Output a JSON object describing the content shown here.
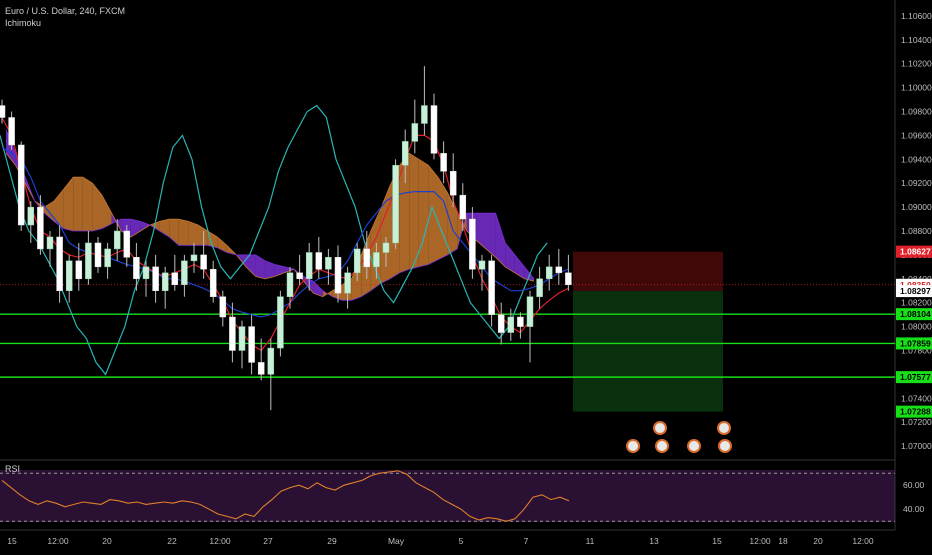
{
  "symbol_title": "Euro / U.S. Dollar, 240, FXCM",
  "indicator_name": "Ichimoku",
  "rsi_name": "RSI",
  "colors": {
    "background": "#000000",
    "up_candle": "#c8f0d8",
    "down_candle": "#ffffff",
    "wick": "#bfbfbf",
    "tenkan": "#e0202a",
    "kijun": "#1f3fcf",
    "chikou": "#2ab5b5",
    "cloud_bull": "#c7782e",
    "cloud_bear": "#7a2fd6",
    "level_line": "#18e018",
    "rsi_line": "#e0802a",
    "rsi_band": "#2a1033",
    "current_price": "#e0202a"
  },
  "price_axis": {
    "ticks": [
      "1.10600",
      "1.10400",
      "1.10200",
      "1.10000",
      "1.09800",
      "1.09600",
      "1.09400",
      "1.09200",
      "1.09000",
      "1.08800",
      "1.08600",
      "1.08400",
      "1.08200",
      "1.08000",
      "1.07800",
      "1.07600",
      "1.07400",
      "1.07200",
      "1.07000"
    ],
    "badges": [
      {
        "label": "1.08627",
        "value": 1.08627,
        "color": "#e0202a",
        "text_color": "#ffffff"
      },
      {
        "label": "1.08350",
        "value": 1.0835,
        "color": "#ffffff",
        "text_color": "#d02020"
      },
      {
        "label": "1.08297",
        "value": 1.08297,
        "color": "#ffffff",
        "text_color": "#000000"
      },
      {
        "label": "1.08104",
        "value": 1.08104,
        "color": "#18e018",
        "text_color": "#000000"
      },
      {
        "label": "1.07859",
        "value": 1.07859,
        "color": "#18e018",
        "text_color": "#000000"
      },
      {
        "label": "1.07577",
        "value": 1.07577,
        "color": "#18e018",
        "text_color": "#000000"
      },
      {
        "label": "1.07288",
        "value": 1.07288,
        "color": "#18e018",
        "text_color": "#000000"
      }
    ]
  },
  "rsi_axis": {
    "ticks": [
      "60.00",
      "40.00"
    ]
  },
  "time_axis": {
    "ticks": [
      "15",
      "12:00",
      "20",
      "22",
      "12:00",
      "27",
      "29",
      "May",
      "5",
      "7",
      "11",
      "13",
      "15",
      "12:00",
      "18",
      "20",
      "12:00"
    ]
  },
  "chart_data": {
    "type": "candlestick",
    "title": "Euro / U.S. Dollar, 240, FXCM",
    "indicators": [
      "Ichimoku",
      "RSI"
    ],
    "y_range": [
      1.069,
      1.107
    ],
    "rsi_range": [
      26,
      76
    ],
    "rsi_levels": [
      70,
      30
    ],
    "current_price": 1.0835,
    "horizontal_levels": [
      1.08104,
      1.07859,
      1.07577
    ],
    "position_tool": {
      "entry": 1.08297,
      "stop": 1.08627,
      "target": 1.07288
    },
    "candles": [
      [
        1.0985,
        1.099,
        1.097,
        1.0975
      ],
      [
        1.0975,
        1.098,
        1.0948,
        1.0952
      ],
      [
        1.0952,
        1.0955,
        1.088,
        1.0885
      ],
      [
        1.0885,
        1.0905,
        1.087,
        1.09
      ],
      [
        1.09,
        1.091,
        1.086,
        1.0865
      ],
      [
        1.0865,
        1.088,
        1.085,
        1.0875
      ],
      [
        1.0875,
        1.0885,
        1.082,
        1.083
      ],
      [
        1.083,
        1.086,
        1.082,
        1.0855
      ],
      [
        1.0855,
        1.087,
        1.083,
        1.084
      ],
      [
        1.084,
        1.088,
        1.0835,
        1.087
      ],
      [
        1.087,
        1.0875,
        1.0845,
        1.085
      ],
      [
        1.085,
        1.087,
        1.084,
        1.0865
      ],
      [
        1.0865,
        1.089,
        1.0855,
        1.088
      ],
      [
        1.088,
        1.0885,
        1.085,
        1.0858
      ],
      [
        1.0858,
        1.087,
        1.083,
        1.084
      ],
      [
        1.084,
        1.0855,
        1.0825,
        1.085
      ],
      [
        1.085,
        1.086,
        1.082,
        1.083
      ],
      [
        1.083,
        1.085,
        1.0815,
        1.0845
      ],
      [
        1.0845,
        1.086,
        1.083,
        1.0835
      ],
      [
        1.0835,
        1.086,
        1.0825,
        1.0855
      ],
      [
        1.0855,
        1.087,
        1.0845,
        1.086
      ],
      [
        1.086,
        1.088,
        1.084,
        1.0848
      ],
      [
        1.0848,
        1.0855,
        1.082,
        1.0825
      ],
      [
        1.0825,
        1.083,
        1.08,
        1.0808
      ],
      [
        1.0808,
        1.082,
        1.077,
        1.078
      ],
      [
        1.078,
        1.0805,
        1.0765,
        1.08
      ],
      [
        1.08,
        1.081,
        1.076,
        1.077
      ],
      [
        1.077,
        1.079,
        1.0755,
        1.076
      ],
      [
        1.076,
        1.079,
        1.073,
        1.0782
      ],
      [
        1.0782,
        1.083,
        1.0775,
        1.0825
      ],
      [
        1.0825,
        1.085,
        1.0815,
        1.0845
      ],
      [
        1.0845,
        1.086,
        1.0835,
        1.084
      ],
      [
        1.084,
        1.087,
        1.083,
        1.0862
      ],
      [
        1.0862,
        1.0875,
        1.084,
        1.0848
      ],
      [
        1.0848,
        1.0865,
        1.0835,
        1.0858
      ],
      [
        1.0858,
        1.0868,
        1.082,
        1.0828
      ],
      [
        1.0828,
        1.085,
        1.0815,
        1.0845
      ],
      [
        1.0845,
        1.087,
        1.0838,
        1.0865
      ],
      [
        1.0865,
        1.088,
        1.084,
        1.085
      ],
      [
        1.085,
        1.087,
        1.084,
        1.0862
      ],
      [
        1.0862,
        1.0875,
        1.085,
        1.087
      ],
      [
        1.087,
        1.094,
        1.0865,
        1.0935
      ],
      [
        1.0935,
        1.0965,
        1.092,
        1.0955
      ],
      [
        1.0955,
        1.099,
        1.0945,
        1.097
      ],
      [
        1.097,
        1.1018,
        1.096,
        1.0985
      ],
      [
        1.0985,
        1.0995,
        1.094,
        1.0945
      ],
      [
        1.0945,
        1.0955,
        1.092,
        1.093
      ],
      [
        1.093,
        1.0945,
        1.09,
        1.091
      ],
      [
        1.091,
        1.092,
        1.088,
        1.089
      ],
      [
        1.089,
        1.09,
        1.084,
        1.0848
      ],
      [
        1.0848,
        1.086,
        1.083,
        1.0855
      ],
      [
        1.0855,
        1.086,
        1.08,
        1.081
      ],
      [
        1.081,
        1.082,
        1.0785,
        1.0795
      ],
      [
        1.0795,
        1.0815,
        1.0788,
        1.0808
      ],
      [
        1.0808,
        1.0812,
        1.079,
        1.08
      ],
      [
        1.08,
        1.083,
        1.077,
        1.0825
      ],
      [
        1.0825,
        1.085,
        1.0815,
        1.084
      ],
      [
        1.084,
        1.086,
        1.083,
        1.085
      ],
      [
        1.085,
        1.0865,
        1.0835,
        1.0845
      ],
      [
        1.0845,
        1.086,
        1.083,
        1.0835
      ]
    ],
    "rsi": [
      64,
      58,
      52,
      47,
      44,
      47,
      45,
      42,
      44,
      46,
      45,
      44,
      48,
      47,
      45,
      46,
      44,
      45,
      46,
      45,
      47,
      46,
      44,
      40,
      36,
      34,
      32,
      36,
      34,
      42,
      48,
      55,
      58,
      60,
      57,
      62,
      58,
      56,
      60,
      62,
      64,
      68,
      70,
      71,
      72,
      69,
      62,
      58,
      54,
      48,
      44,
      40,
      34,
      31,
      33,
      32,
      30,
      32,
      40,
      50,
      52,
      48,
      50,
      47
    ],
    "tenkan_series": [
      1.0975,
      1.096,
      1.093,
      1.09,
      1.088,
      1.0875,
      1.0865,
      1.086,
      1.0858,
      1.0862,
      1.086,
      1.0858,
      1.0862,
      1.0865,
      1.0855,
      1.085,
      1.0845,
      1.0842,
      1.0845,
      1.0848,
      1.0852,
      1.0848,
      1.0835,
      1.0822,
      1.0805,
      1.0795,
      1.0785,
      1.078,
      1.079,
      1.0805,
      1.082,
      1.0835,
      1.0842,
      1.0848,
      1.0845,
      1.0842,
      1.084,
      1.0848,
      1.086,
      1.0875,
      1.0895,
      1.0915,
      1.094,
      1.096,
      1.096,
      1.0955,
      1.0935,
      1.0905,
      1.0885,
      1.086,
      1.084,
      1.0825,
      1.0808,
      1.08,
      1.0795,
      1.0805,
      1.0815,
      1.0822,
      1.0828,
      1.0832
    ],
    "kijun_series": [
      1.095,
      1.0945,
      1.094,
      1.0925,
      1.0905,
      1.0895,
      1.0885,
      1.087,
      1.0865,
      1.0862,
      1.086,
      1.0858,
      1.0855,
      1.0852,
      1.085,
      1.0848,
      1.0845,
      1.084,
      1.084,
      1.0838,
      1.0835,
      1.0832,
      1.0828,
      1.0822,
      1.0815,
      1.0812,
      1.081,
      1.0808,
      1.081,
      1.0815,
      1.082,
      1.0828,
      1.0835,
      1.084,
      1.0842,
      1.0845,
      1.0855,
      1.087,
      1.0885,
      1.0895,
      1.0905,
      1.091,
      1.0912,
      1.0913,
      1.0913,
      1.0913,
      1.0905,
      1.088,
      1.087,
      1.086,
      1.085,
      1.084,
      1.0835,
      1.083,
      1.083,
      1.0832,
      1.0835,
      1.084,
      1.0845,
      1.0848
    ],
    "chikou_series": [
      1.096,
      1.093,
      1.09,
      1.088,
      1.087,
      1.0855,
      1.084,
      1.082,
      1.08,
      1.079,
      1.077,
      1.076,
      1.078,
      1.08,
      1.083,
      1.085,
      1.088,
      1.092,
      1.095,
      1.096,
      1.094,
      1.09,
      1.087,
      1.085,
      1.084,
      1.085,
      1.086,
      1.088,
      1.09,
      1.093,
      1.095,
      1.0965,
      1.098,
      1.0985,
      1.0975,
      1.094,
      1.092,
      1.09,
      1.087,
      1.085,
      1.083,
      1.082,
      1.0835,
      1.085,
      1.087,
      1.09,
      1.088,
      1.086,
      1.084,
      1.082,
      1.081,
      1.08,
      1.079,
      1.08,
      1.082,
      1.084,
      1.086,
      1.087
    ],
    "cloud_span_a": [
      1.0945,
      1.0935,
      1.092,
      1.0905,
      1.09,
      1.0905,
      1.0915,
      1.0925,
      1.0925,
      1.092,
      1.091,
      1.0895,
      1.088,
      1.0875,
      1.088,
      1.0885,
      1.0888,
      1.089,
      1.089,
      1.0888,
      1.0885,
      1.088,
      1.0875,
      1.0868,
      1.086,
      1.085,
      1.0842,
      1.084,
      1.0842,
      1.0845,
      1.0848,
      1.0838,
      1.0828,
      1.0825,
      1.083,
      1.0835,
      1.084,
      1.086,
      1.088,
      1.0898,
      1.0918,
      1.0935,
      1.0945,
      1.094,
      1.0935,
      1.0925,
      1.0912,
      1.0895,
      1.088,
      1.0872,
      1.0865,
      1.0858,
      1.085,
      1.0845,
      1.084,
      1.0838
    ],
    "cloud_span_b": [
      1.0965,
      1.0945,
      1.0925,
      1.0905,
      1.0895,
      1.0888,
      1.0882,
      1.088,
      1.088,
      1.088,
      1.0882,
      1.0886,
      1.089,
      1.089,
      1.0888,
      1.0885,
      1.088,
      1.0875,
      1.0868,
      1.0868,
      1.0868,
      1.0868,
      1.0866,
      1.0862,
      1.086,
      1.086,
      1.086,
      1.0855,
      1.0852,
      1.085,
      1.0848,
      1.0842,
      1.0838,
      1.083,
      1.0825,
      1.0822,
      1.0822,
      1.0825,
      1.083,
      1.0836,
      1.084,
      1.0845,
      1.0848,
      1.085,
      1.0852,
      1.0856,
      1.086,
      1.0865,
      1.0895,
      1.0895,
      1.0895,
      1.0895,
      1.087,
      1.086,
      1.085,
      1.084
    ]
  }
}
